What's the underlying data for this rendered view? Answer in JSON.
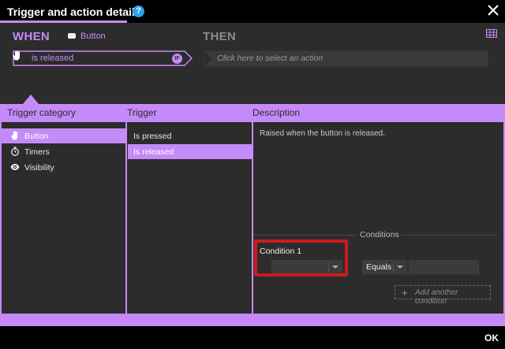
{
  "window": {
    "title": "Trigger and action details",
    "help_glyph": "?"
  },
  "when": {
    "label": "WHEN",
    "object_label": "Button",
    "trigger_text": "is released",
    "if_badge": "IF"
  },
  "then": {
    "label": "THEN",
    "action_placeholder": "Click here to select an action"
  },
  "columns": {
    "trigger_category": "Trigger category",
    "trigger": "Trigger",
    "description": "Description"
  },
  "categories": [
    {
      "label": "Button",
      "icon": "hand-icon",
      "selected": true
    },
    {
      "label": "Timers",
      "icon": "stopwatch-icon",
      "selected": false
    },
    {
      "label": "Visibility",
      "icon": "eye-icon",
      "selected": false
    }
  ],
  "triggers": [
    {
      "label": "Is pressed",
      "selected": false
    },
    {
      "label": "Is released",
      "selected": true
    }
  ],
  "description_text": "Raised when the button is released.",
  "conditions": {
    "title": "Conditions",
    "condition_label": "Condition 1",
    "first_dropdown_value": "",
    "operator_value": "Equals",
    "value_field": "",
    "add_label": "Add another condition"
  },
  "footer": {
    "ok_label": "OK"
  },
  "colors": {
    "accent": "#c58af9",
    "highlight": "#cc1b1b",
    "panel": "#2c2c2c"
  }
}
